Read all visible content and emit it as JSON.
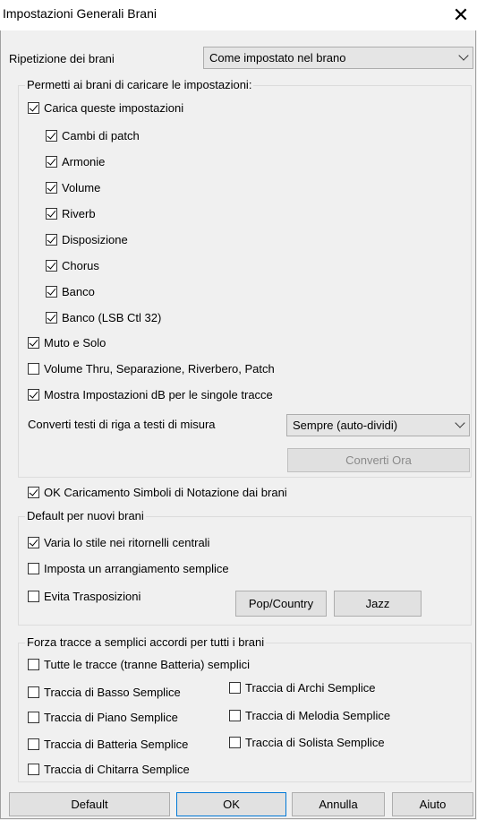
{
  "dialog": {
    "title": "Impostazioni Generali Brani",
    "close_glyph": "✕"
  },
  "repeat": {
    "label": "Ripetizione dei brani",
    "value": "Come impostato nel brano"
  },
  "load_group": {
    "title": "Permetti ai brani di caricare le impostazioni:",
    "load_settings": {
      "label": "Carica queste impostazioni",
      "checked": true
    },
    "sub_items": [
      {
        "label": "Cambi di patch",
        "checked": true
      },
      {
        "label": "Armonie",
        "checked": true
      },
      {
        "label": "Volume",
        "checked": true
      },
      {
        "label": "Riverb",
        "checked": true
      },
      {
        "label": "Disposizione",
        "checked": true
      },
      {
        "label": "Chorus",
        "checked": true
      },
      {
        "label": "Banco",
        "checked": true
      },
      {
        "label": "Banco (LSB Ctl 32)",
        "checked": true
      }
    ],
    "mute_solo": {
      "label": "Muto e Solo",
      "checked": true
    },
    "volume_thru": {
      "label": "Volume Thru, Separazione, Riverbero, Patch",
      "checked": false
    },
    "show_db": {
      "label": "Mostra Impostazioni dB per le singole tracce",
      "checked": true
    },
    "convert_label": "Converti testi di riga a testi di misura",
    "convert_value": "Sempre (auto-dividi)",
    "convert_now": "Converti Ora"
  },
  "notation": {
    "label": "OK Caricamento Simboli di Notazione dai brani",
    "checked": true
  },
  "new_songs": {
    "title": "Default per nuovi brani",
    "vary_style": {
      "label": "Varia lo stile nei ritornelli centrali",
      "checked": true
    },
    "simple_arr": {
      "label": "Imposta un arrangiamento semplice",
      "checked": false
    },
    "avoid_transp": {
      "label": "Evita Trasposizioni",
      "checked": false
    },
    "pop_country": "Pop/Country",
    "jazz": "Jazz"
  },
  "force_group": {
    "title": "Forza tracce a semplici accordi per tutti i brani",
    "all_tracks": {
      "label": "Tutte le tracce (tranne Batteria) semplici",
      "checked": false
    },
    "bass": {
      "label": "Traccia di Basso Semplice",
      "checked": false
    },
    "strings": {
      "label": "Traccia di Archi Semplice",
      "checked": false
    },
    "piano": {
      "label": "Traccia di Piano Semplice",
      "checked": false
    },
    "melody": {
      "label": "Traccia di Melodia Semplice",
      "checked": false
    },
    "drums": {
      "label": "Traccia di Batteria Semplice",
      "checked": false
    },
    "soloist": {
      "label": "Traccia di Solista Semplice",
      "checked": false
    },
    "guitar": {
      "label": "Traccia di Chitarra Semplice",
      "checked": false
    }
  },
  "buttons": {
    "default": "Default",
    "ok": "OK",
    "cancel": "Annulla",
    "help": "Aiuto"
  }
}
